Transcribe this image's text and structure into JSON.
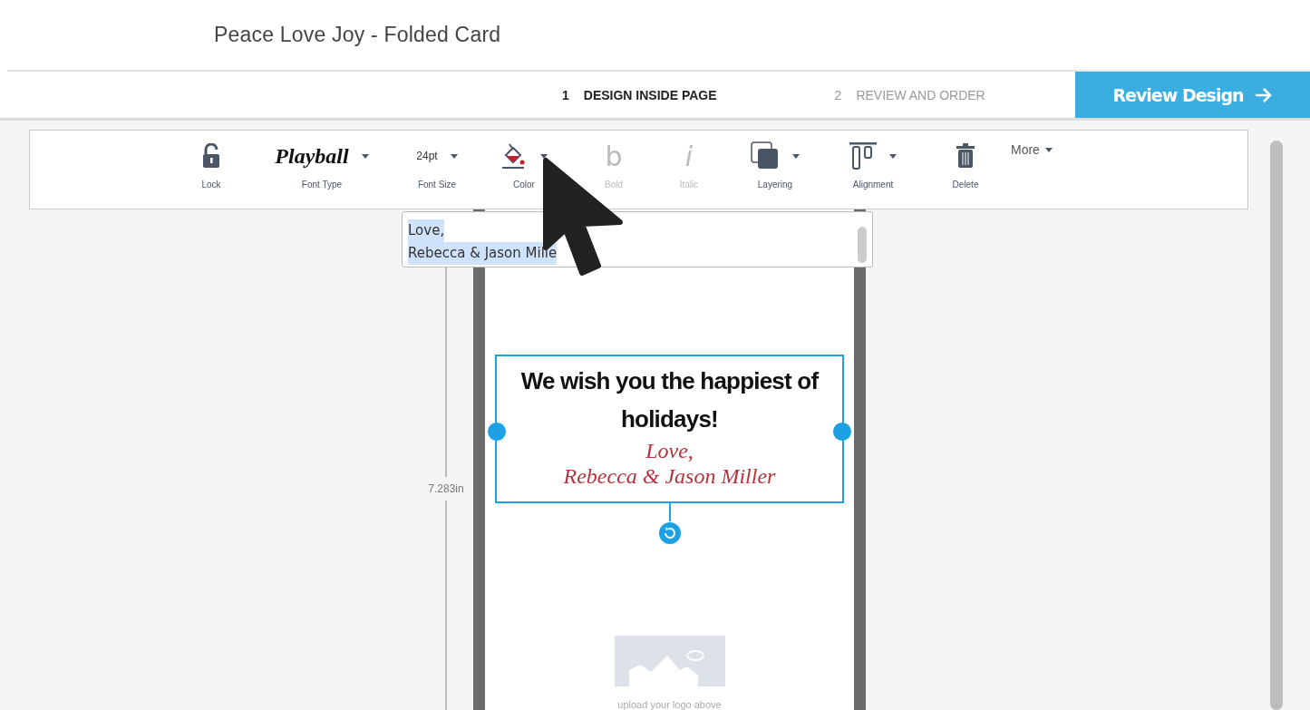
{
  "title": "Peace Love Joy - Folded Card",
  "steps": [
    {
      "number": "1",
      "label": "DESIGN INSIDE PAGE",
      "selected": true
    },
    {
      "number": "2",
      "label": "REVIEW AND ORDER",
      "selected": false
    }
  ],
  "review_button": {
    "label": "Review Design"
  },
  "toolbar": {
    "items": [
      {
        "kind": "lock",
        "label": "Lock",
        "disabled": false
      },
      {
        "kind": "font",
        "value": "Playball",
        "label": "Font Type",
        "disabled": false
      },
      {
        "kind": "size",
        "value": "24pt",
        "label": "Font Size",
        "disabled": false
      },
      {
        "kind": "color",
        "label": "Color",
        "disabled": false
      },
      {
        "kind": "bold",
        "glyph": "b",
        "label": "Bold",
        "disabled": true
      },
      {
        "kind": "italic",
        "glyph": "i",
        "label": "Italic",
        "disabled": true
      },
      {
        "kind": "layering",
        "label": "Layering",
        "disabled": false
      },
      {
        "kind": "alignment",
        "label": "Alignment",
        "disabled": false
      },
      {
        "kind": "delete",
        "label": "Delete",
        "disabled": false
      },
      {
        "kind": "more",
        "label": "More",
        "disabled": false
      }
    ]
  },
  "text_editor": {
    "lines": [
      "Love,",
      "Rebecca & Jason Mille"
    ]
  },
  "ruler": {
    "label": "7.283in"
  },
  "card": {
    "headline": "We wish you the happiest of holidays!",
    "script_lines": [
      "Love,",
      "Rebecca & Jason Miller"
    ],
    "selected": true,
    "logo_hint": "upload your logo above"
  }
}
